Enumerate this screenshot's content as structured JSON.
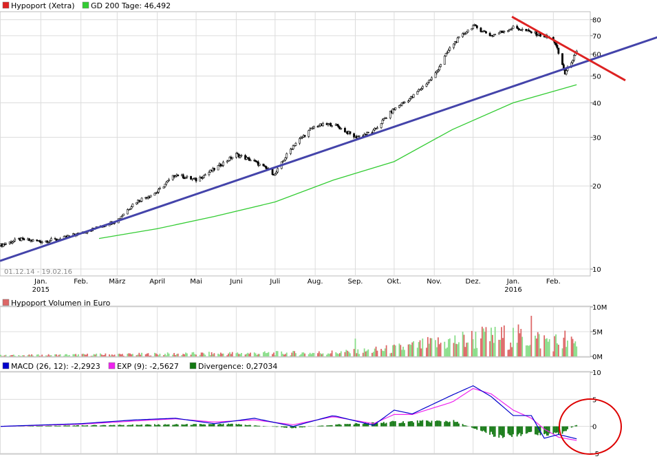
{
  "colors": {
    "grid": "#dcdcdc",
    "price_candle": "#000000",
    "ma200": "#33cc33",
    "trend_support": "#4444aa",
    "trend_resistance": "#dd2222",
    "triangle_fill": "#f5deaa",
    "volume_up": "#88dd88",
    "volume_down": "#dd6666",
    "macd": "#0000cc",
    "signal": "#ee22ee",
    "divergence": "#117711",
    "circle": "#dd0000"
  },
  "legend": {
    "price": "Hypoport (Xetra)",
    "ma200": "GD 200 Tage: 46,492",
    "volume": "Hypoport Volumen in Euro",
    "macd": "MACD (26, 12): -2,2923",
    "exp": "EXP (9): -2,5627",
    "divergence": "Divergence: 0,27034"
  },
  "date_range": "01.12.14 - 19.02.16",
  "x_month_labels": [
    "Jan.",
    "Feb.",
    "März",
    "April",
    "Mai",
    "Juni",
    "Juli",
    "Aug.",
    "Sep.",
    "Okt.",
    "Nov.",
    "Dez.",
    "Jan.",
    "Feb."
  ],
  "x_year_labels": [
    "2015",
    "2016"
  ],
  "chart_data": [
    {
      "type": "candlestick",
      "title": "Hypoport (Xetra)",
      "y_scale": "log",
      "ylim": [
        9.5,
        85
      ],
      "y_ticks": [
        "10",
        "20",
        "30",
        "40",
        "50",
        "60",
        "70",
        "80"
      ],
      "x_start": "2014-12-01",
      "x_end": "2016-02-19",
      "close_series": {
        "dates": [
          "2014-12-01",
          "2014-12-15",
          "2015-01-01",
          "2015-01-15",
          "2015-02-01",
          "2015-02-15",
          "2015-03-01",
          "2015-03-15",
          "2015-04-01",
          "2015-04-15",
          "2015-05-01",
          "2015-05-15",
          "2015-06-01",
          "2015-06-15",
          "2015-07-01",
          "2015-07-15",
          "2015-08-01",
          "2015-08-15",
          "2015-09-01",
          "2015-09-15",
          "2015-10-01",
          "2015-10-15",
          "2015-11-01",
          "2015-11-15",
          "2015-12-01",
          "2015-12-15",
          "2016-01-01",
          "2016-01-15",
          "2016-02-01",
          "2016-02-10",
          "2016-02-19"
        ],
        "values": [
          12.2,
          12.8,
          12.6,
          12.8,
          13.5,
          14.2,
          15.0,
          17.5,
          19.0,
          22.0,
          21.0,
          23.0,
          26.0,
          24.5,
          22.0,
          28.0,
          33.0,
          33.5,
          30.0,
          31.5,
          38.0,
          42.0,
          50.0,
          65.0,
          76.0,
          70.0,
          75.0,
          72.0,
          68.0,
          51.0,
          61.0
        ]
      },
      "ma200": {
        "dates": [
          "2015-02-15",
          "2015-04-01",
          "2015-05-15",
          "2015-07-01",
          "2015-08-15",
          "2015-10-01",
          "2015-11-15",
          "2016-01-01",
          "2016-02-19"
        ],
        "values": [
          12.9,
          14.0,
          15.5,
          17.5,
          21.0,
          24.5,
          32.0,
          40.0,
          46.5
        ]
      },
      "trend_support": {
        "dates": [
          "2014-12-01",
          "2016-02-29"
        ],
        "values": [
          10.7,
          57.0
        ]
      },
      "trend_resistance": {
        "dates": [
          "2015-12-31",
          "2016-02-29"
        ],
        "values": [
          82.0,
          57.0
        ]
      }
    },
    {
      "type": "bar",
      "title": "Hypoport Volumen in Euro",
      "ylim": [
        0,
        10000000
      ],
      "y_ticks": [
        "0M",
        "5M",
        "10M"
      ],
      "x_start": "2014-12-01",
      "x_end": "2016-02-19",
      "samples": {
        "dates": [
          "2014-12-01",
          "2015-03-01",
          "2015-06-01",
          "2015-08-01",
          "2015-09-01",
          "2015-10-01",
          "2015-11-01",
          "2015-12-01",
          "2016-01-01",
          "2016-02-01",
          "2016-02-19"
        ],
        "values": [
          200000,
          400000,
          600000,
          700000,
          900000,
          1500000,
          2500000,
          3500000,
          4000000,
          3000000,
          2500000
        ]
      },
      "peak_days": [
        {
          "date": "2015-09-01",
          "value": 3600000
        },
        {
          "date": "2015-12-08",
          "value": 6000000
        },
        {
          "date": "2016-01-15",
          "value": 8200000
        },
        {
          "date": "2016-02-10",
          "value": 5200000
        }
      ]
    },
    {
      "type": "line",
      "title": "MACD",
      "ylim": [
        -5,
        10
      ],
      "y_ticks": [
        "-5",
        "0",
        "5",
        "10"
      ],
      "series": [
        {
          "name": "MACD (26, 12)",
          "dates": [
            "2014-12-01",
            "2015-02-01",
            "2015-03-15",
            "2015-04-15",
            "2015-05-15",
            "2015-06-15",
            "2015-07-15",
            "2015-08-15",
            "2015-09-15",
            "2015-10-01",
            "2015-10-15",
            "2015-11-15",
            "2015-12-01",
            "2015-12-15",
            "2016-01-01",
            "2016-01-15",
            "2016-01-25",
            "2016-02-05",
            "2016-02-19"
          ],
          "values": [
            0,
            0.5,
            1.2,
            1.5,
            0.5,
            1.5,
            0,
            2.0,
            0.2,
            3.0,
            2.3,
            5.8,
            7.5,
            5.5,
            2.0,
            2.0,
            -2.2,
            -1.5,
            -2.3
          ]
        },
        {
          "name": "EXP (9)",
          "dates": [
            "2014-12-01",
            "2015-02-01",
            "2015-03-15",
            "2015-04-15",
            "2015-05-15",
            "2015-06-15",
            "2015-07-15",
            "2015-08-15",
            "2015-09-15",
            "2015-10-01",
            "2015-10-15",
            "2015-11-15",
            "2015-12-01",
            "2015-12-15",
            "2016-01-01",
            "2016-01-15",
            "2016-01-25",
            "2016-02-05",
            "2016-02-19"
          ],
          "values": [
            0,
            0.4,
            1.0,
            1.4,
            0.8,
            1.2,
            0.3,
            1.8,
            0.5,
            2.2,
            2.2,
            4.5,
            7.0,
            6.0,
            3.0,
            1.5,
            -0.5,
            -2.0,
            -2.6
          ]
        },
        {
          "name": "Divergence",
          "type": "bar",
          "dates": [
            "2014-12-01",
            "2015-03-15",
            "2015-06-01",
            "2015-07-15",
            "2015-08-15",
            "2015-10-01",
            "2015-11-15",
            "2015-12-20",
            "2016-01-15",
            "2016-02-05",
            "2016-02-19"
          ],
          "values": [
            0,
            0.3,
            0.4,
            -0.3,
            0.3,
            0.8,
            1.0,
            -1.8,
            -1.2,
            -1.5,
            0.27
          ]
        }
      ]
    }
  ]
}
